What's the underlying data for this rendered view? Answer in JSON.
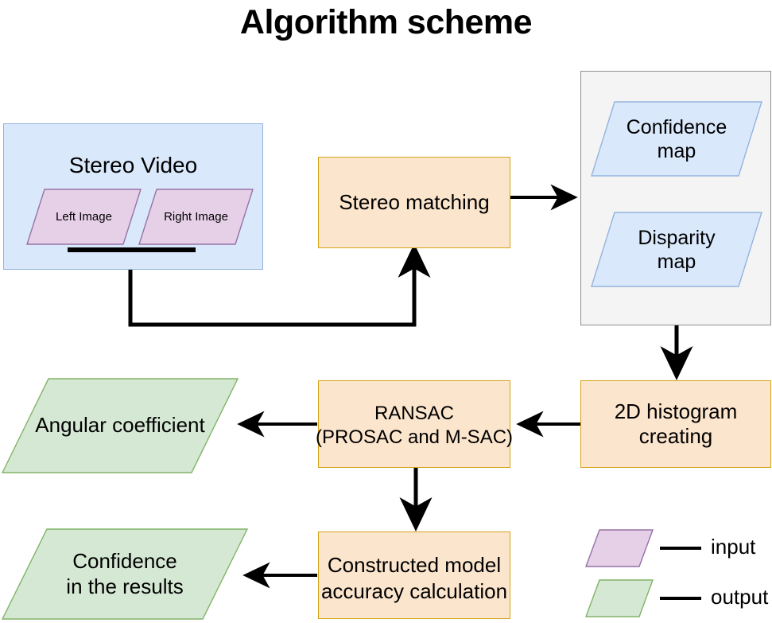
{
  "diagram": {
    "title": "Algorithm scheme",
    "nodes": {
      "stereo_video": {
        "label": "Stereo Video",
        "fill": "#dae8fc",
        "stroke": "#95b3dd",
        "children": [
          {
            "label": "Left Image",
            "fill": "#e6d0e8",
            "stroke": "#9673a6"
          },
          {
            "label": "Right Image",
            "fill": "#e6d0e8",
            "stroke": "#9673a6"
          }
        ]
      },
      "stereo_matching": {
        "label": "Stereo matching",
        "fill": "#fce5cd",
        "stroke": "#d6a419"
      },
      "maps_group": {
        "fill": "#f4f4f4",
        "stroke": "#8f8f8f",
        "children": [
          {
            "label_line1": "Confidence",
            "label_line2": "map",
            "fill": "#dae8fc",
            "stroke": "#95b3dd"
          },
          {
            "label_line1": "Disparity",
            "label_line2": "map",
            "fill": "#dae8fc",
            "stroke": "#95b3dd"
          }
        ]
      },
      "histogram": {
        "label_line1": "2D histogram",
        "label_line2": "creating",
        "fill": "#fce5cd",
        "stroke": "#d6a419"
      },
      "ransac": {
        "label_line1": "RANSAC",
        "label_line2": "(PROSAC and M-SAC)",
        "fill": "#fce5cd",
        "stroke": "#d6a419"
      },
      "angular_coefficient": {
        "label": "Angular coefficient",
        "fill": "#d5e8d4",
        "stroke": "#82b366"
      },
      "accuracy": {
        "label_line1": "Constructed model",
        "label_line2": "accuracy calculation",
        "fill": "#fce5cd",
        "stroke": "#d6a419"
      },
      "confidence_results": {
        "label_line1": "Confidence",
        "label_line2": "in the results",
        "fill": "#d5e8d4",
        "stroke": "#82b366"
      }
    },
    "legend": {
      "items": [
        {
          "label": "input",
          "fill": "#e6d0e8",
          "stroke": "#9673a6"
        },
        {
          "label": "output",
          "fill": "#d5e8d4",
          "stroke": "#82b366"
        }
      ]
    },
    "edge_color": "#000000"
  }
}
